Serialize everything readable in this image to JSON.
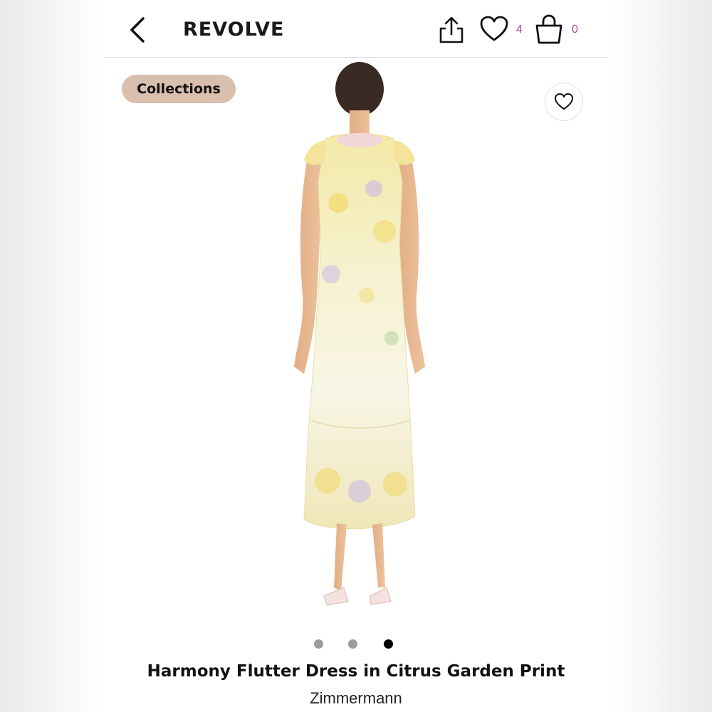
{
  "header": {
    "logo": "REVOLVE",
    "wishlist_count": "4",
    "bag_count": "0",
    "count_color": "#b0479b",
    "icons": [
      "back-arrow-icon",
      "share-icon",
      "heart-icon",
      "shopping-bag-icon"
    ]
  },
  "badge": {
    "label": "Collections",
    "color": "#d9bfae"
  },
  "product": {
    "name": "Harmony Flutter Dress in Citrus Garden Print",
    "brand": "Zimmermann",
    "image_count": 3,
    "active_image": 3
  }
}
